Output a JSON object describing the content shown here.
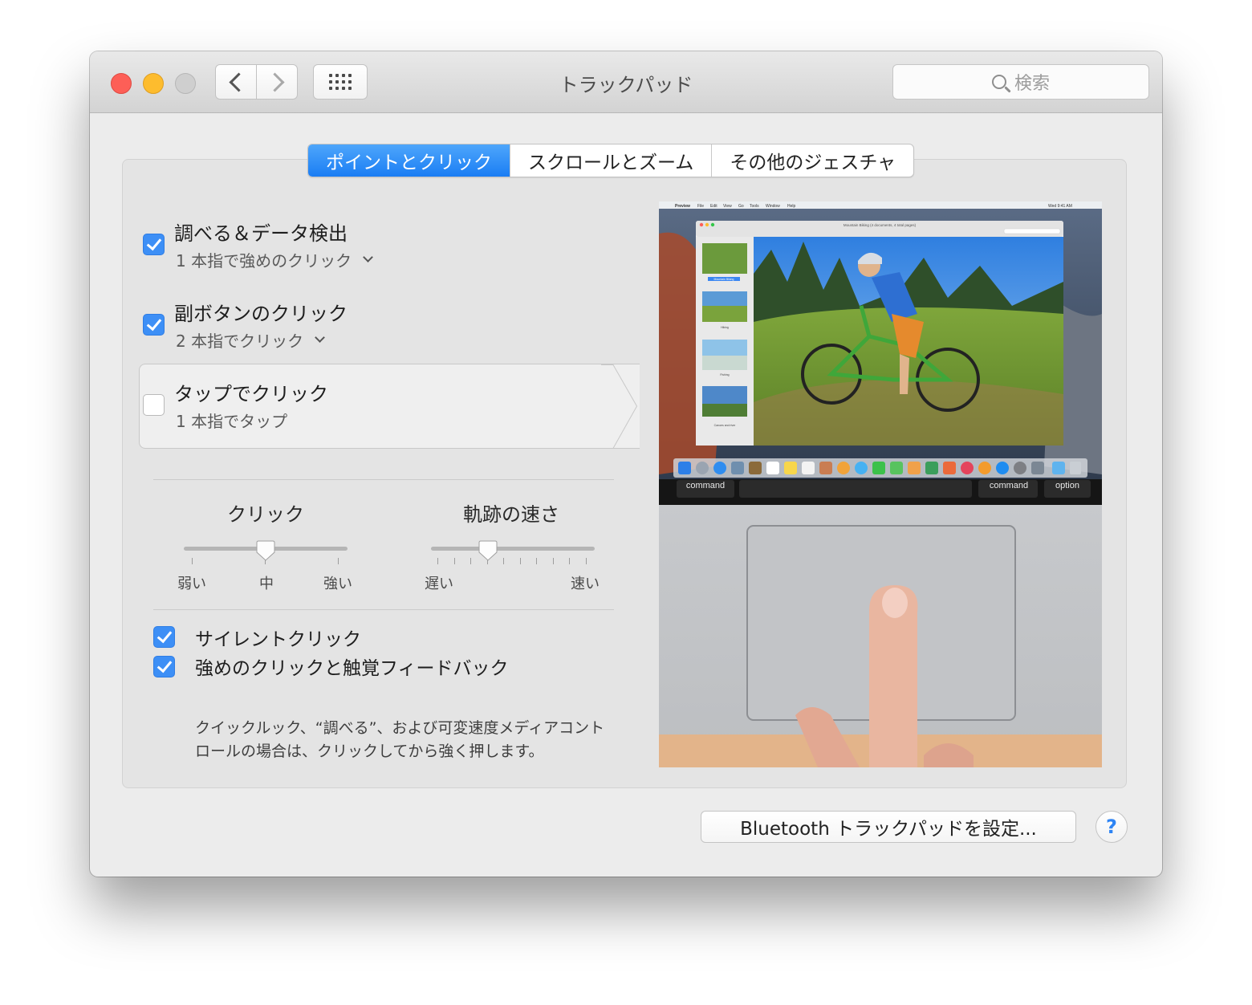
{
  "window": {
    "title": "トラックパッド"
  },
  "toolbar": {
    "search_placeholder": "検索"
  },
  "tabs": [
    {
      "label": "ポイントとクリック",
      "active": true
    },
    {
      "label": "スクロールとズーム",
      "active": false
    },
    {
      "label": "その他のジェスチャ",
      "active": false
    }
  ],
  "options": [
    {
      "title": "調べる＆データ検出",
      "subtitle": "1 本指で強めのクリック",
      "checked": true,
      "has_dropdown": true
    },
    {
      "title": "副ボタンのクリック",
      "subtitle": "2 本指でクリック",
      "checked": true,
      "has_dropdown": true
    },
    {
      "title": "タップでクリック",
      "subtitle": "1 本指でタップ",
      "checked": false,
      "has_dropdown": false
    }
  ],
  "sliders": {
    "click": {
      "label": "クリック",
      "min_label": "弱い",
      "mid_label": "中",
      "max_label": "強い",
      "value": 0.5
    },
    "tracking": {
      "label": "軌跡の速さ",
      "min_label": "遅い",
      "max_label": "速い",
      "value": 0.35
    }
  },
  "checkboxes": [
    {
      "label": "サイレントクリック",
      "checked": true
    },
    {
      "label": "強めのクリックと触覚フィードバック",
      "checked": true
    }
  ],
  "force_click_description": "クイックルック、“調べる”、および可変速度メディアコントロールの場合は、クリックしてから強く押します。",
  "preview": {
    "menubar": [
      "Preview",
      "File",
      "Edit",
      "View",
      "Go",
      "Tools",
      "Window",
      "Help"
    ],
    "clock": "Wed 9:41 AM",
    "doc_title": "Mountain Biking (4 documents, 4 total pages)",
    "thumbnails": [
      "Mountain Biking",
      "Hiking",
      "Fishing",
      "Canoes and river"
    ],
    "keys": [
      "command",
      "command",
      "option"
    ]
  },
  "buttons": {
    "bluetooth": "Bluetooth トラックパッドを設定...",
    "help": "?"
  },
  "colors": {
    "accent": "#1a7df4",
    "close": "#fd5f57",
    "minimize": "#fdbc2e"
  }
}
